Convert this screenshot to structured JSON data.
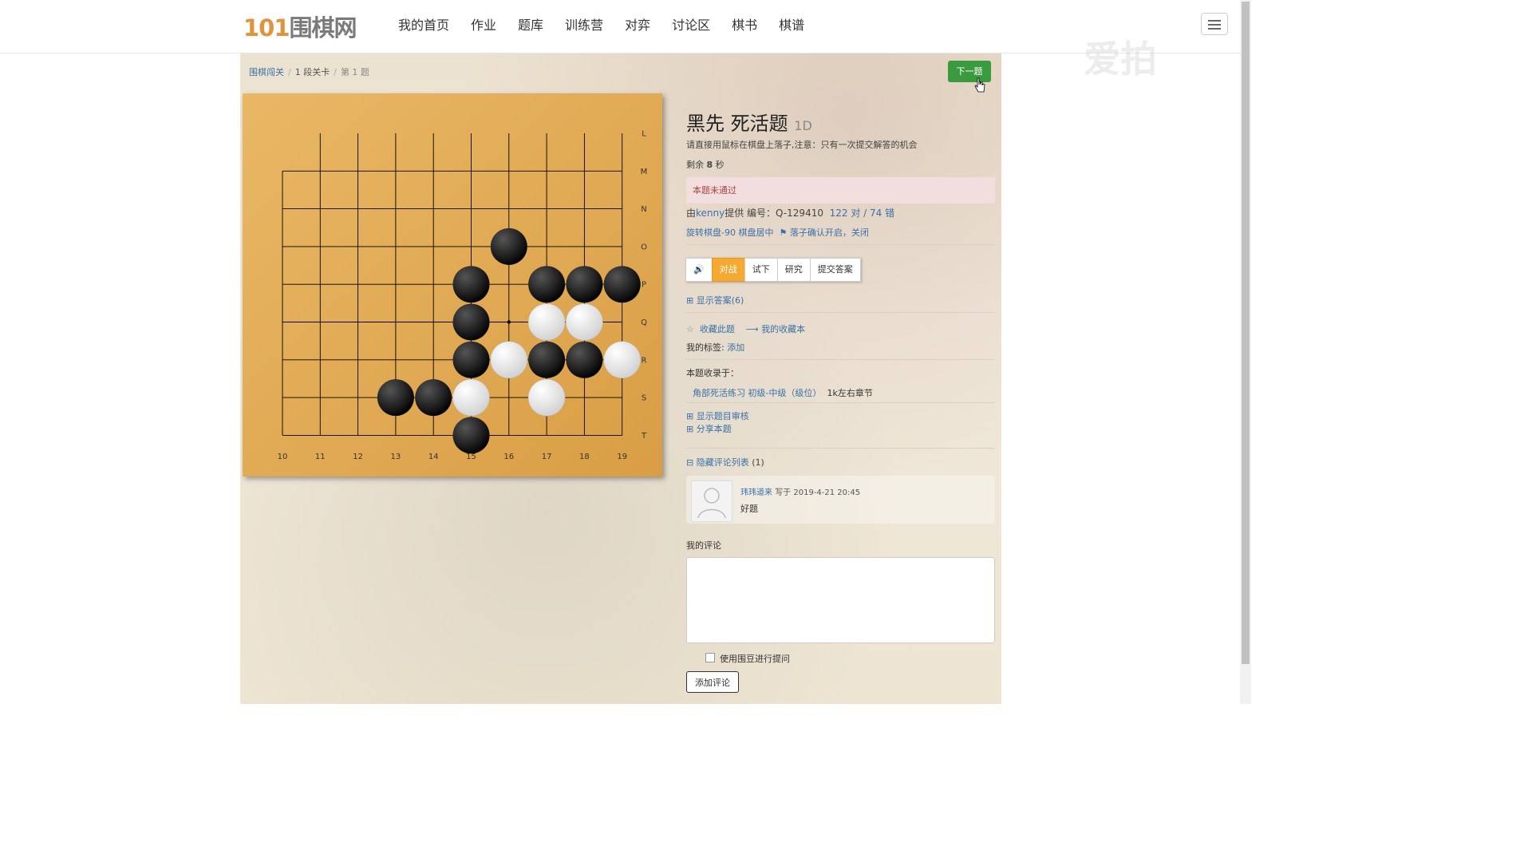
{
  "logo": {
    "number": "101",
    "text": "围棋网"
  },
  "nav": [
    "我的首页",
    "作业",
    "题库",
    "训练营",
    "对弈",
    "讨论区",
    "棋书",
    "棋谱"
  ],
  "watermark": "爱拍",
  "breadcrumb": {
    "root": "围棋闯关",
    "level": "1 段关卡",
    "current": "第 1 题"
  },
  "next_button": "下一题",
  "problem": {
    "title": "黑先 死活题",
    "level": "1D",
    "hint": "请直接用鼠标在棋盘上落子,注意：只有一次提交解答的机会",
    "timer_prefix": "剩余",
    "timer_value": "8",
    "timer_unit": "秒",
    "status": "本题未通过",
    "provider_prefix": "由",
    "provider": "kenny",
    "provider_suffix": "提供 编号：Q-129410",
    "stats": "122 对 / 74 错",
    "rotate": "旋转棋盘-90",
    "center": "棋盘居中",
    "confirm": "落子确认开启，关闭"
  },
  "modes": [
    "🔊",
    "对战",
    "试下",
    "研究",
    "提交答案"
  ],
  "show_answer": "显示答案(6)",
  "favorite": "收藏此题",
  "my_favorites": "我的收藏本",
  "tags_label": "我的标签:",
  "tags_add": "添加",
  "included_label": "本题收录于：",
  "included_link": "角部死活练习 初级-中级（级位）",
  "included_chapter": "1k左右章节",
  "show_review": "显示题目审核",
  "share": "分享本题",
  "hide_comments": "隐藏评论列表",
  "comment_count": "(1)",
  "comment": {
    "author": "玮玮道来",
    "meta": "写于 2019-4-21 20:45",
    "text": "好题"
  },
  "my_comment_label": "我的评论",
  "use_beans": "使用围豆进行提问",
  "add_comment": "添加评论",
  "board": {
    "x_labels": [
      "10",
      "11",
      "12",
      "13",
      "14",
      "15",
      "16",
      "17",
      "18",
      "19"
    ],
    "y_labels": [
      "L",
      "M",
      "N",
      "O",
      "P",
      "Q",
      "R",
      "S",
      "T"
    ],
    "black": [
      [
        16,
        "O"
      ],
      [
        15,
        "P"
      ],
      [
        17,
        "P"
      ],
      [
        18,
        "P"
      ],
      [
        19,
        "P"
      ],
      [
        15,
        "Q"
      ],
      [
        15,
        "R"
      ],
      [
        17,
        "R"
      ],
      [
        18,
        "R"
      ],
      [
        13,
        "S"
      ],
      [
        14,
        "S"
      ],
      [
        15,
        "T"
      ]
    ],
    "white": [
      [
        17,
        "Q"
      ],
      [
        18,
        "Q"
      ],
      [
        16,
        "R"
      ],
      [
        19,
        "R"
      ],
      [
        15,
        "S"
      ],
      [
        17,
        "S"
      ]
    ],
    "star": [
      [
        16,
        "Q"
      ]
    ],
    "colors": {
      "wood_light": "#e9b765",
      "wood_dark": "#d99e45"
    }
  }
}
